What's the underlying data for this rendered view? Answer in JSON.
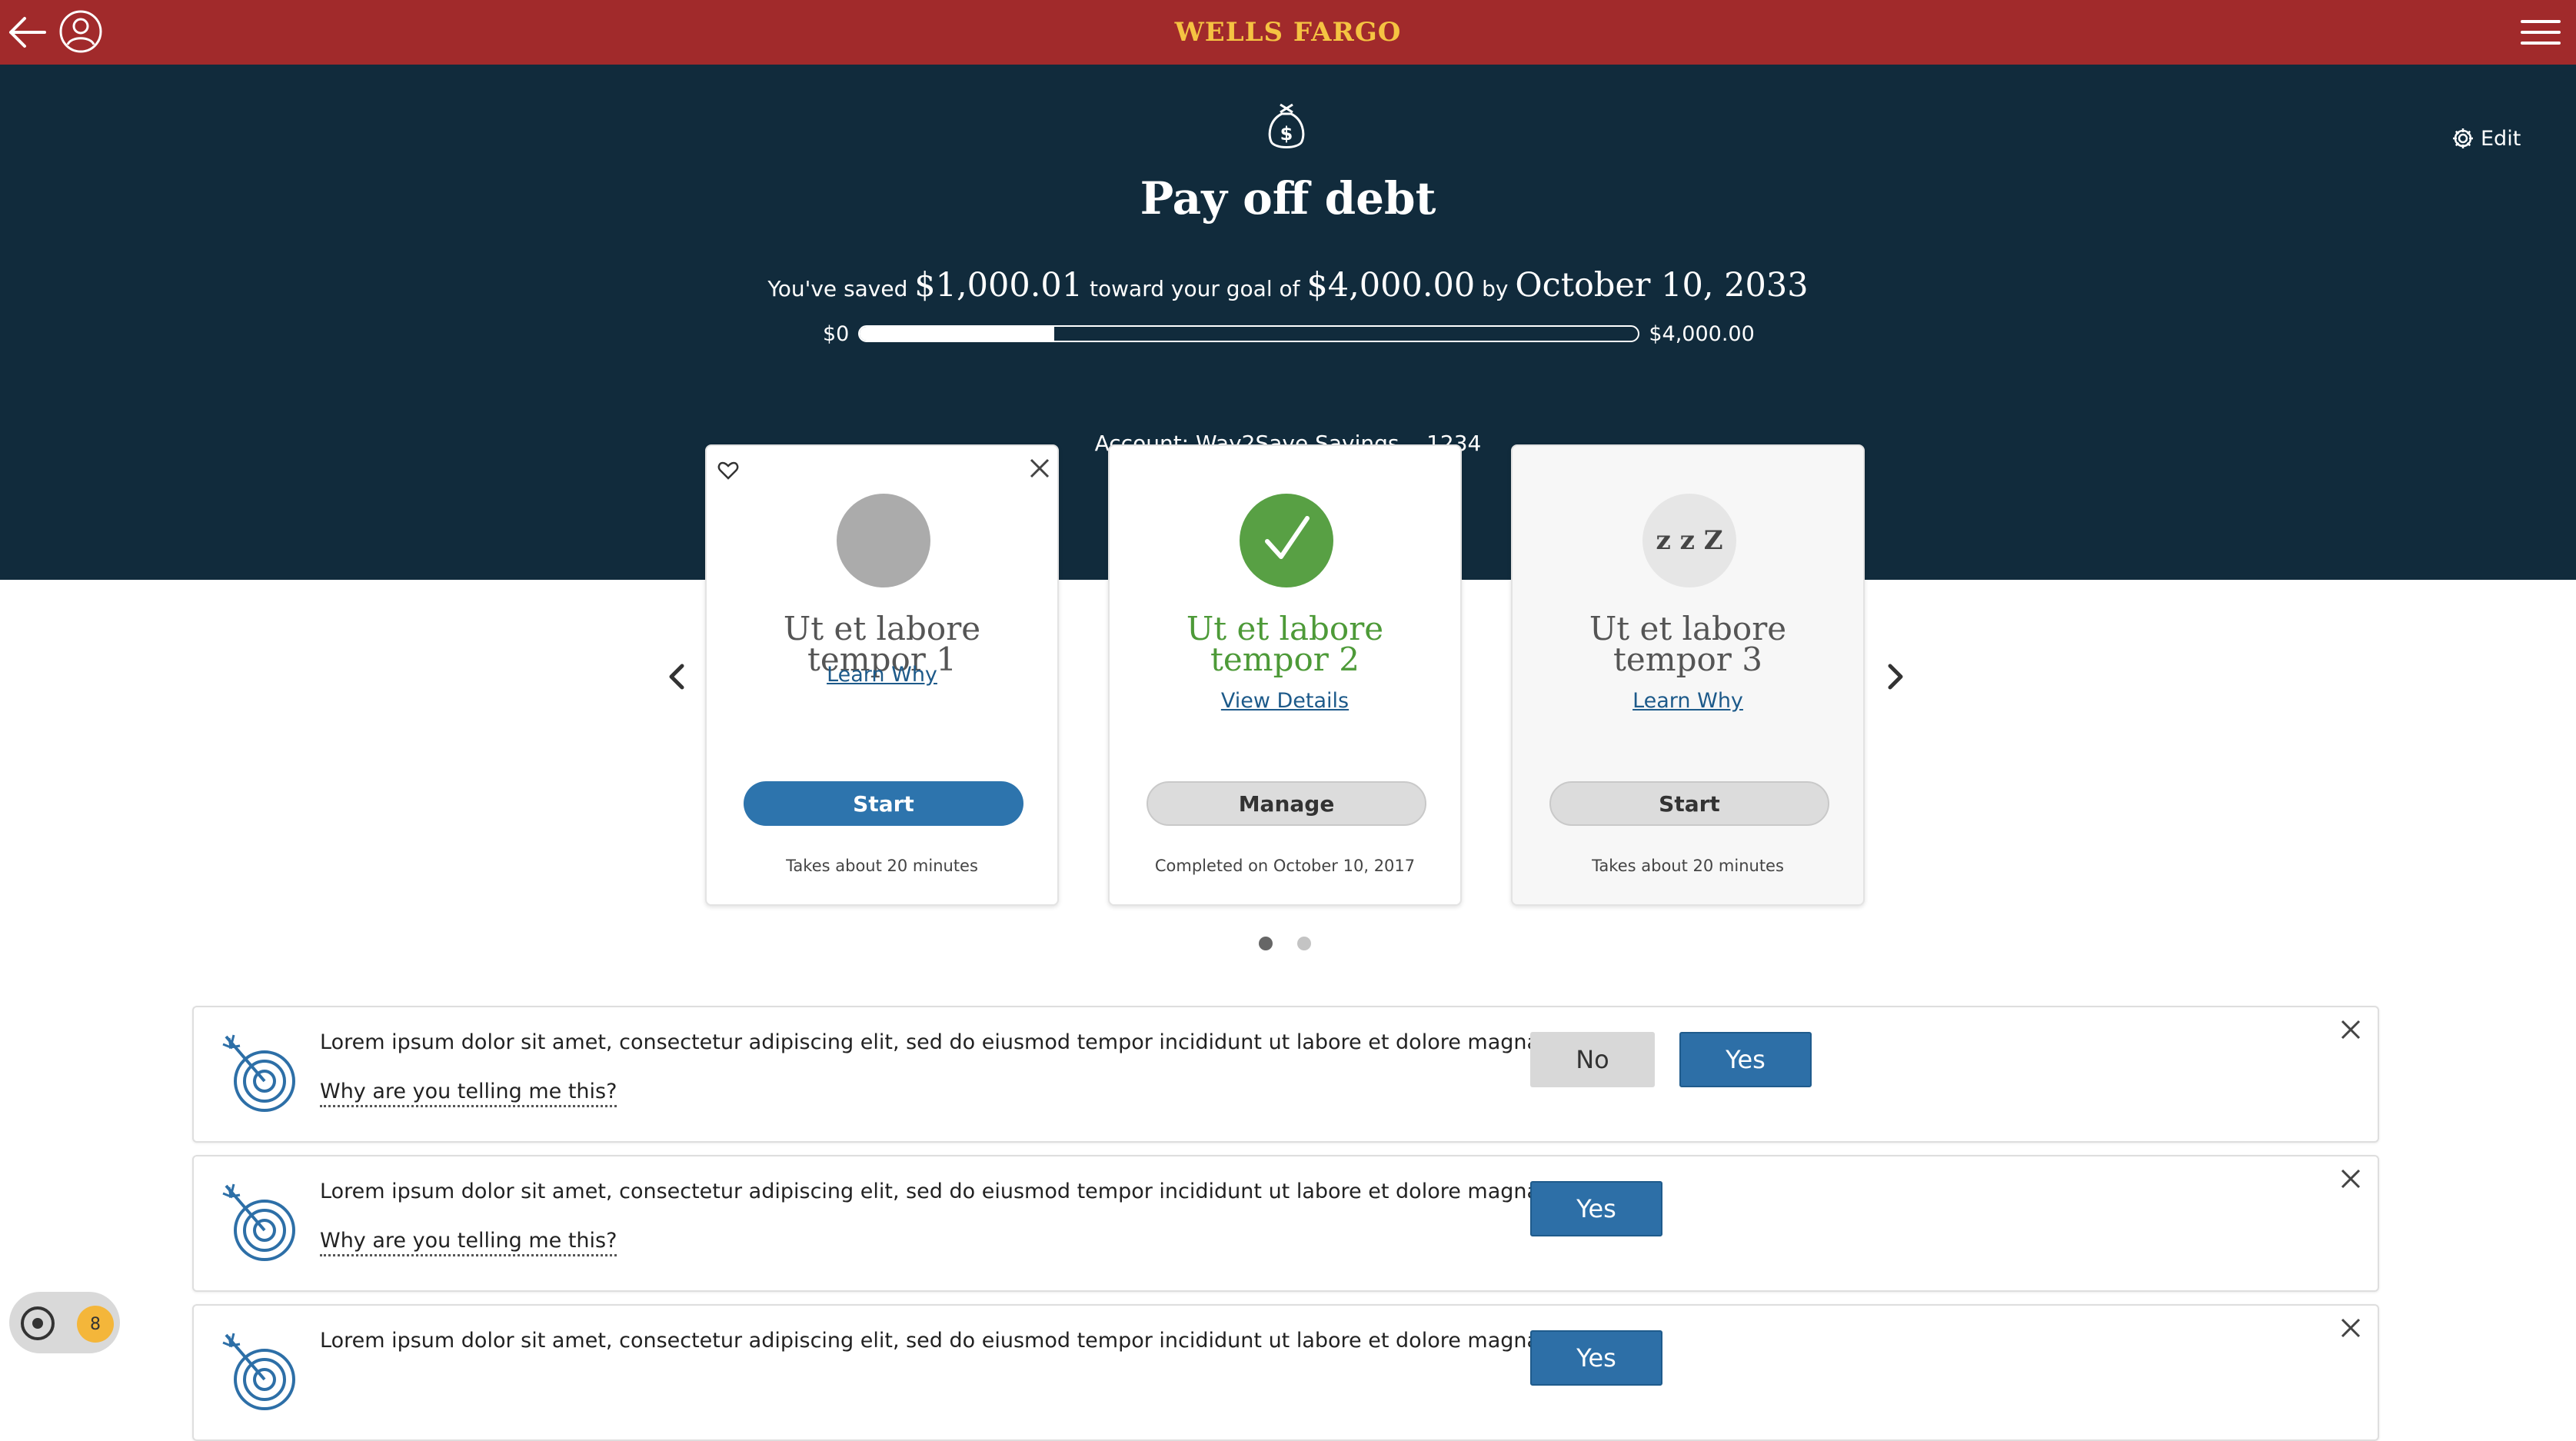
{
  "header": {
    "brand": "WELLS FARGO",
    "back_icon": "back-arrow-icon",
    "profile_icon": "user-icon",
    "menu_icon": "hamburger-menu-icon",
    "brand_color": "#a12a2b",
    "logo_color": "#f5c342"
  },
  "goal": {
    "icon": "money-bag-icon",
    "edit_label": "Edit",
    "title": "Pay off debt",
    "saved_prefix": "You've saved",
    "saved_amount": "$1,000.01",
    "toward_text": "toward your goal of",
    "goal_amount": "$4,000.00",
    "by_text": "by",
    "target_date": "October 10, 2033",
    "progress_min": "$0",
    "progress_max": "$4,000.00",
    "progress_fraction": 0.25,
    "account_label": "Account:",
    "account_name": "Way2Save Savings ...1234",
    "hero_color": "#112b3c"
  },
  "cards": [
    {
      "title": "Ut et labore tempor 1",
      "link": "Learn Why",
      "button": "Start",
      "note": "Takes about 20 minutes",
      "status": "not-started"
    },
    {
      "title": "Ut et labore tempor 2",
      "link": "View Details",
      "button": "Manage",
      "note": "Completed on October 10, 2017",
      "status": "completed"
    },
    {
      "title": "Ut et labore tempor 3",
      "link": "Learn Why",
      "button": "Start",
      "note": "Takes about 20 minutes",
      "status": "snoozed",
      "badge_text": "z z Z"
    }
  ],
  "carousel": {
    "page_count": 2,
    "active_page": 1
  },
  "insights": [
    {
      "message": "Lorem ipsum dolor sit amet, consectetur adipiscing elit, sed do eiusmod tempor incididunt ut labore et dolore magna.",
      "why": "Why are you telling me this?",
      "no_label": "No",
      "yes_label": "Yes"
    },
    {
      "message": "Lorem ipsum dolor sit amet, consectetur adipiscing elit, sed do eiusmod tempor incididunt ut labore et dolore magna.",
      "why": "Why are you telling me this?",
      "yes_label": "Yes"
    },
    {
      "message": "Lorem ipsum dolor sit amet, consectetur adipiscing elit, sed do eiusmod tempor incididunt ut labore et dolore magna.",
      "yes_label": "Yes"
    }
  ],
  "widget": {
    "badge_count": "8"
  }
}
